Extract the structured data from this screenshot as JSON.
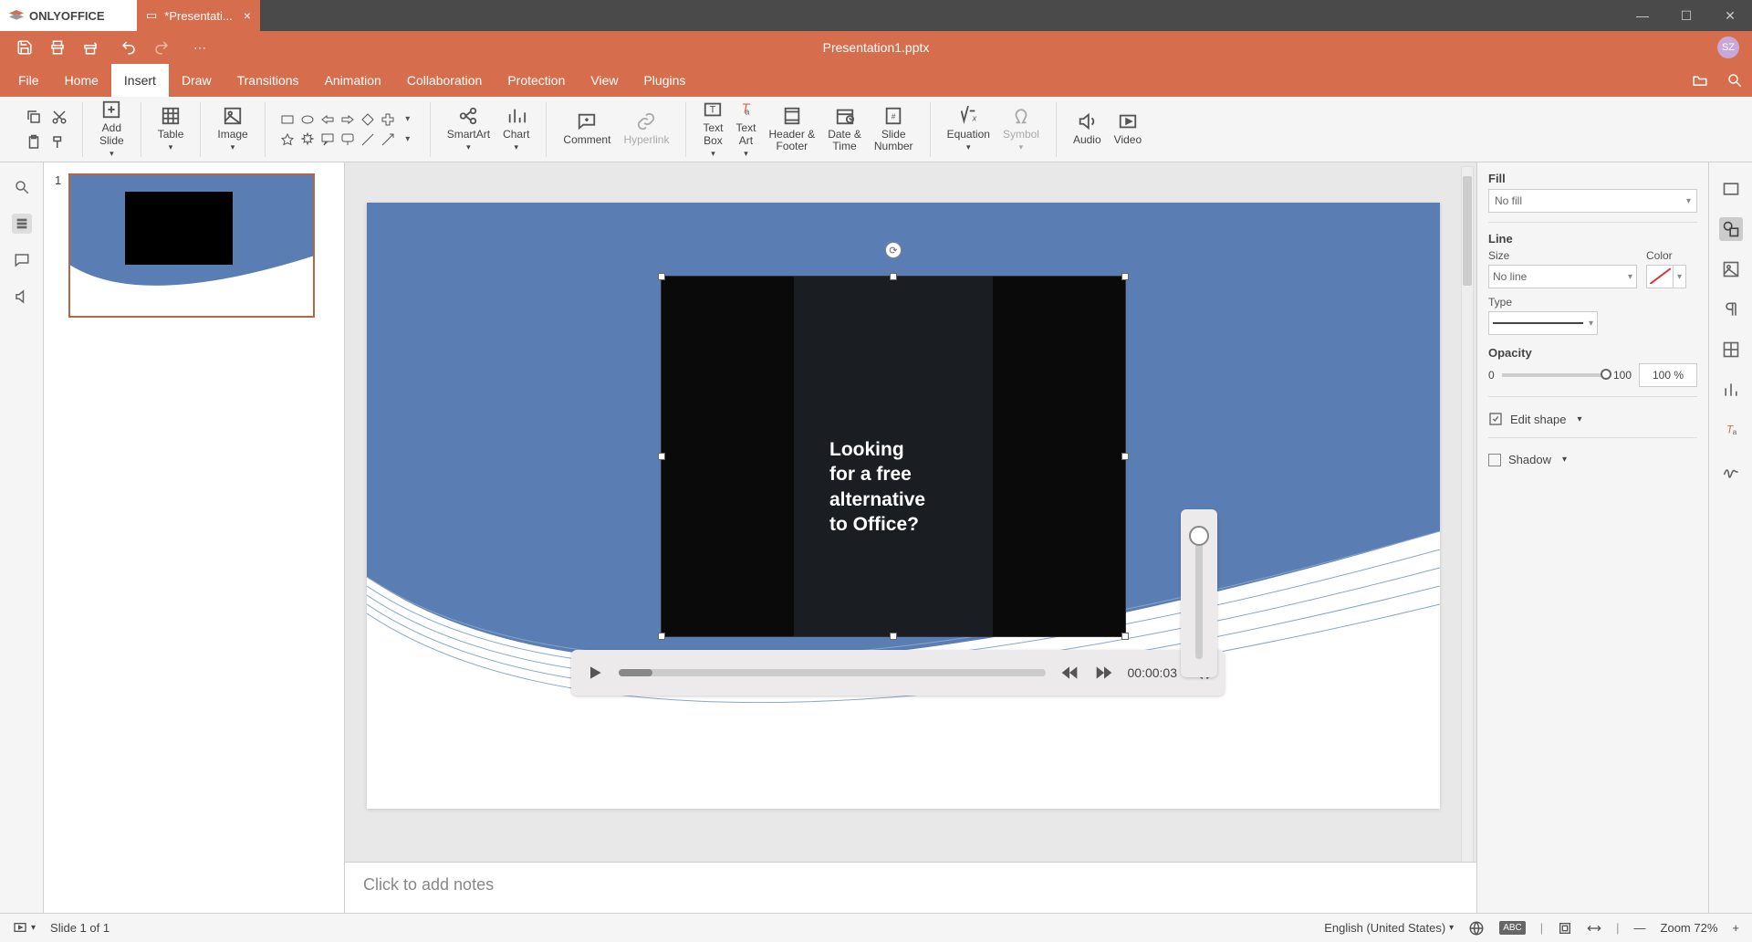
{
  "app_name": "ONLYOFFICE",
  "tab_title": "*Presentati...",
  "doc_title": "Presentation1.pptx",
  "user_initials": "SZ",
  "tabs": [
    "File",
    "Home",
    "Insert",
    "Draw",
    "Transitions",
    "Animation",
    "Collaboration",
    "Protection",
    "View",
    "Plugins"
  ],
  "active_tab": "Insert",
  "ribbon": {
    "add_slide": "Add\nSlide",
    "table": "Table",
    "image": "Image",
    "smartart": "SmartArt",
    "chart": "Chart",
    "comment": "Comment",
    "hyperlink": "Hyperlink",
    "textbox": "Text\nBox",
    "textart": "Text\nArt",
    "headerfooter": "Header &\nFooter",
    "datetime": "Date &\nTime",
    "slidenumber": "Slide\nNumber",
    "equation": "Equation",
    "symbol": "Symbol",
    "audio": "Audio",
    "video": "Video"
  },
  "slide_number": "1",
  "video_text": "Looking\nfor a free\nalternative\nto Office?",
  "media_time": "00:00:03",
  "notes_placeholder": "Click to add notes",
  "right_panel": {
    "fill_label": "Fill",
    "fill_value": "No fill",
    "line_label": "Line",
    "size_label": "Size",
    "size_value": "No line",
    "color_label": "Color",
    "type_label": "Type",
    "opacity_label": "Opacity",
    "opacity_min": "0",
    "opacity_max": "100",
    "opacity_value": "100 %",
    "edit_shape": "Edit shape",
    "shadow": "Shadow"
  },
  "status": {
    "slide_info": "Slide 1 of 1",
    "language": "English (United States)",
    "zoom": "Zoom 72%"
  }
}
